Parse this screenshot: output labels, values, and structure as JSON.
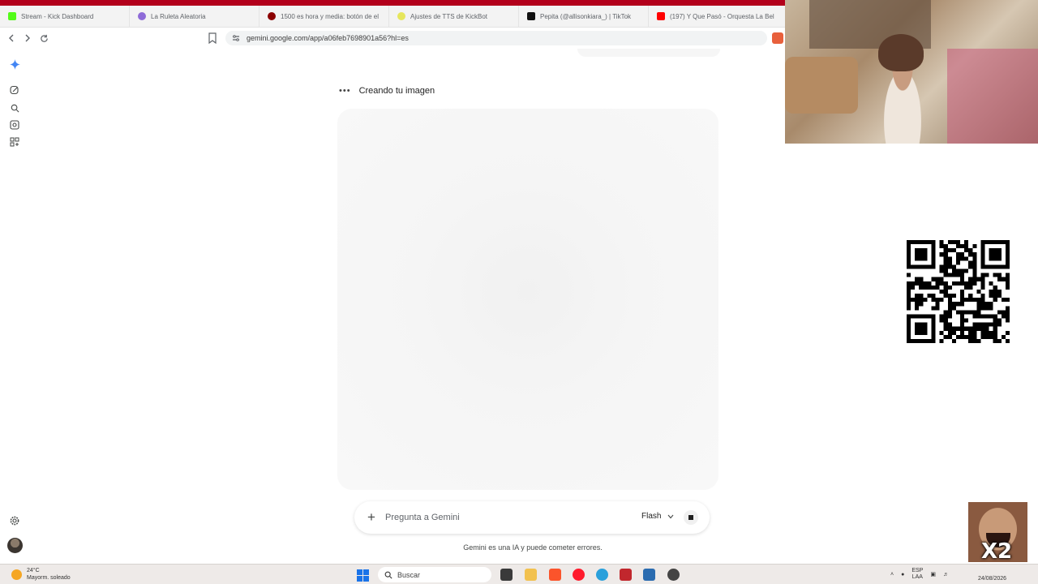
{
  "browser": {
    "tabs": [
      {
        "label": "Stream - Kick Dashboard",
        "favicon_color": "#53fc18",
        "icon": "kick-icon"
      },
      {
        "label": "La Ruleta Aleatoria",
        "favicon_color": "#8e6bd8",
        "icon": "wheel-icon"
      },
      {
        "label": "1500 es hora y media: botón de el",
        "favicon_color": "#8b0000",
        "icon": "record-icon"
      },
      {
        "label": "Ajustes de TTS de KickBot",
        "favicon_color": "#e6e65c",
        "icon": "kickbot-icon"
      },
      {
        "label": "Pepita (@allisonkiara_) | TikTok",
        "favicon_color": "#111111",
        "icon": "tiktok-icon"
      },
      {
        "label": "(197) Y Que Pasó - Orquesta La Bel",
        "favicon_color": "#ff0000",
        "icon": "youtube-icon"
      }
    ],
    "url": "gemini.google.com/app/a06feb7698901a56?hl=es"
  },
  "gemini": {
    "status_text": "Creando tu imagen",
    "status_dots": "•••",
    "prompt_placeholder": "Pregunta a Gemini",
    "model_label": "Flash",
    "disclaimer": "Gemini es una IA y puede cometer errores.",
    "rail_icons": [
      "gemini-spark-icon",
      "new-chat-icon",
      "search-icon",
      "my-stuff-icon",
      "gems-icon"
    ],
    "accent": "#1a73e8"
  },
  "meme": {
    "text": "X2"
  },
  "taskbar": {
    "weather_temp": "24°C",
    "weather_desc": "Mayorm. soleado",
    "search_label": "Buscar",
    "lang_line1": "ESP",
    "lang_line2": "LAA",
    "date": "24/08/2026",
    "app_icons": [
      "windows-start-icon",
      "task-view-icon",
      "file-explorer-icon",
      "brave-icon",
      "opera-icon",
      "edge-icon",
      "app-icon",
      "store-icon",
      "recording-app-icon"
    ]
  }
}
